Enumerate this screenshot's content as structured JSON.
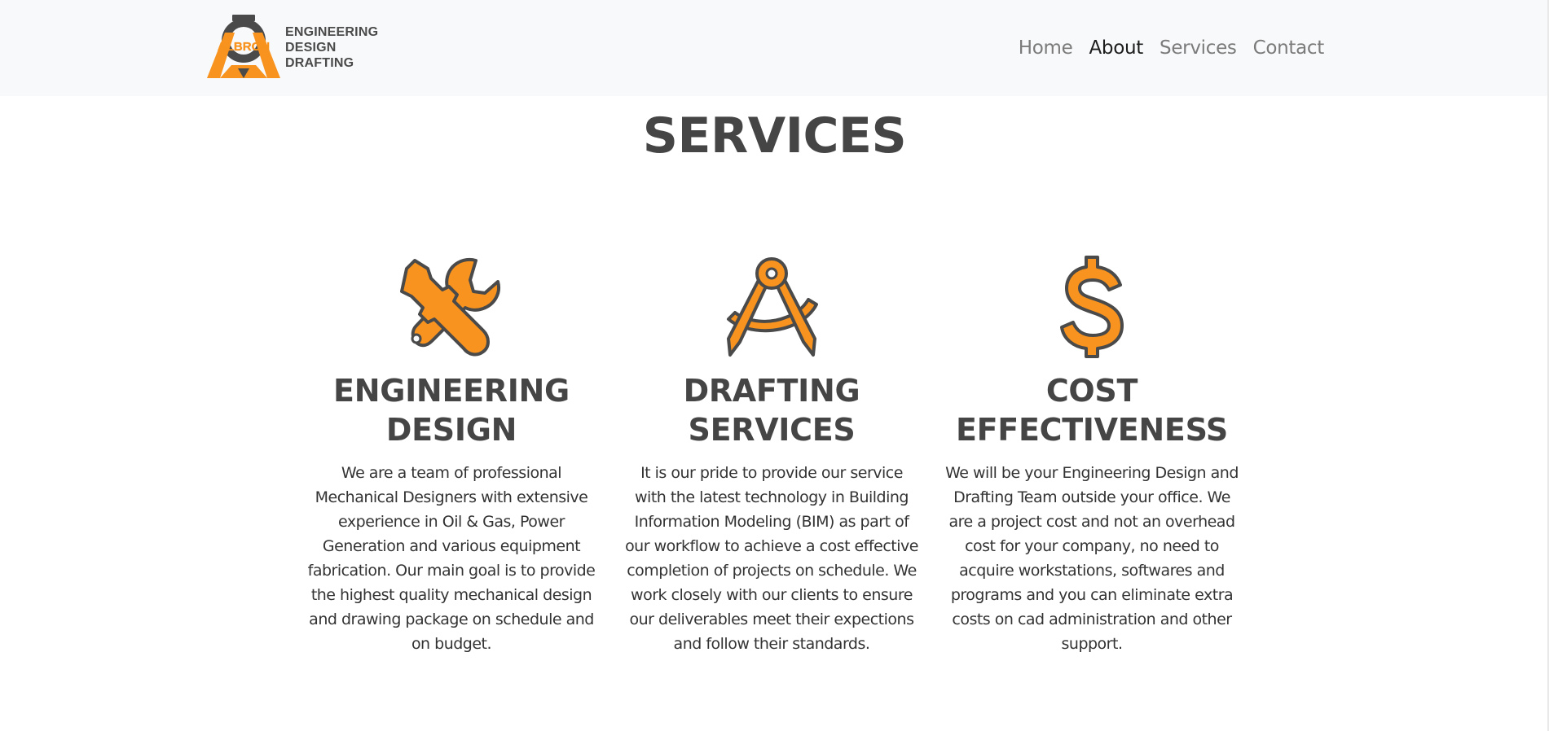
{
  "colors": {
    "accent": "#f7931e",
    "icon_stroke": "#4a4a4a",
    "heading": "#454545",
    "navbar_bg": "#f8f9fa"
  },
  "brand": {
    "logo_text": "ALBRON",
    "lines": [
      "ENGINEERING",
      "DESIGN",
      "DRAFTING"
    ],
    "icon": "gear-a-logo-icon"
  },
  "nav": {
    "items": [
      {
        "label": "Home",
        "active": false
      },
      {
        "label": "About",
        "active": true
      },
      {
        "label": "Services",
        "active": false
      },
      {
        "label": "Contact",
        "active": false
      }
    ]
  },
  "page": {
    "title": "SERVICES"
  },
  "services": [
    {
      "icon": "wrench-screwdriver-icon",
      "title_lines": [
        "ENGINEERING",
        "DESIGN"
      ],
      "text": "We are a team of professional Mechanical Designers with extensive experience in Oil & Gas, Power Generation and various equipment fabrication. Our main goal is to provide the highest quality mechanical design and drawing package on schedule and on budget."
    },
    {
      "icon": "drafting-compass-icon",
      "title_lines": [
        "DRAFTING",
        "SERVICES"
      ],
      "text": "It is our pride to provide our service with the latest technology in Building Information Modeling (BIM) as part of our workflow to achieve a cost effective completion of projects on schedule. We work closely with our clients to ensure our deliverables meet their expections and follow their standards."
    },
    {
      "icon": "dollar-sign-icon",
      "title_lines": [
        "COST",
        "EFFECTIVENESS"
      ],
      "text": "We will be your Engineering Design and Drafting Team outside your office. We are a project cost and not an overhead cost for your company, no need to acquire workstations, softwares and programs and you can eliminate extra costs on cad administration and other support."
    }
  ]
}
